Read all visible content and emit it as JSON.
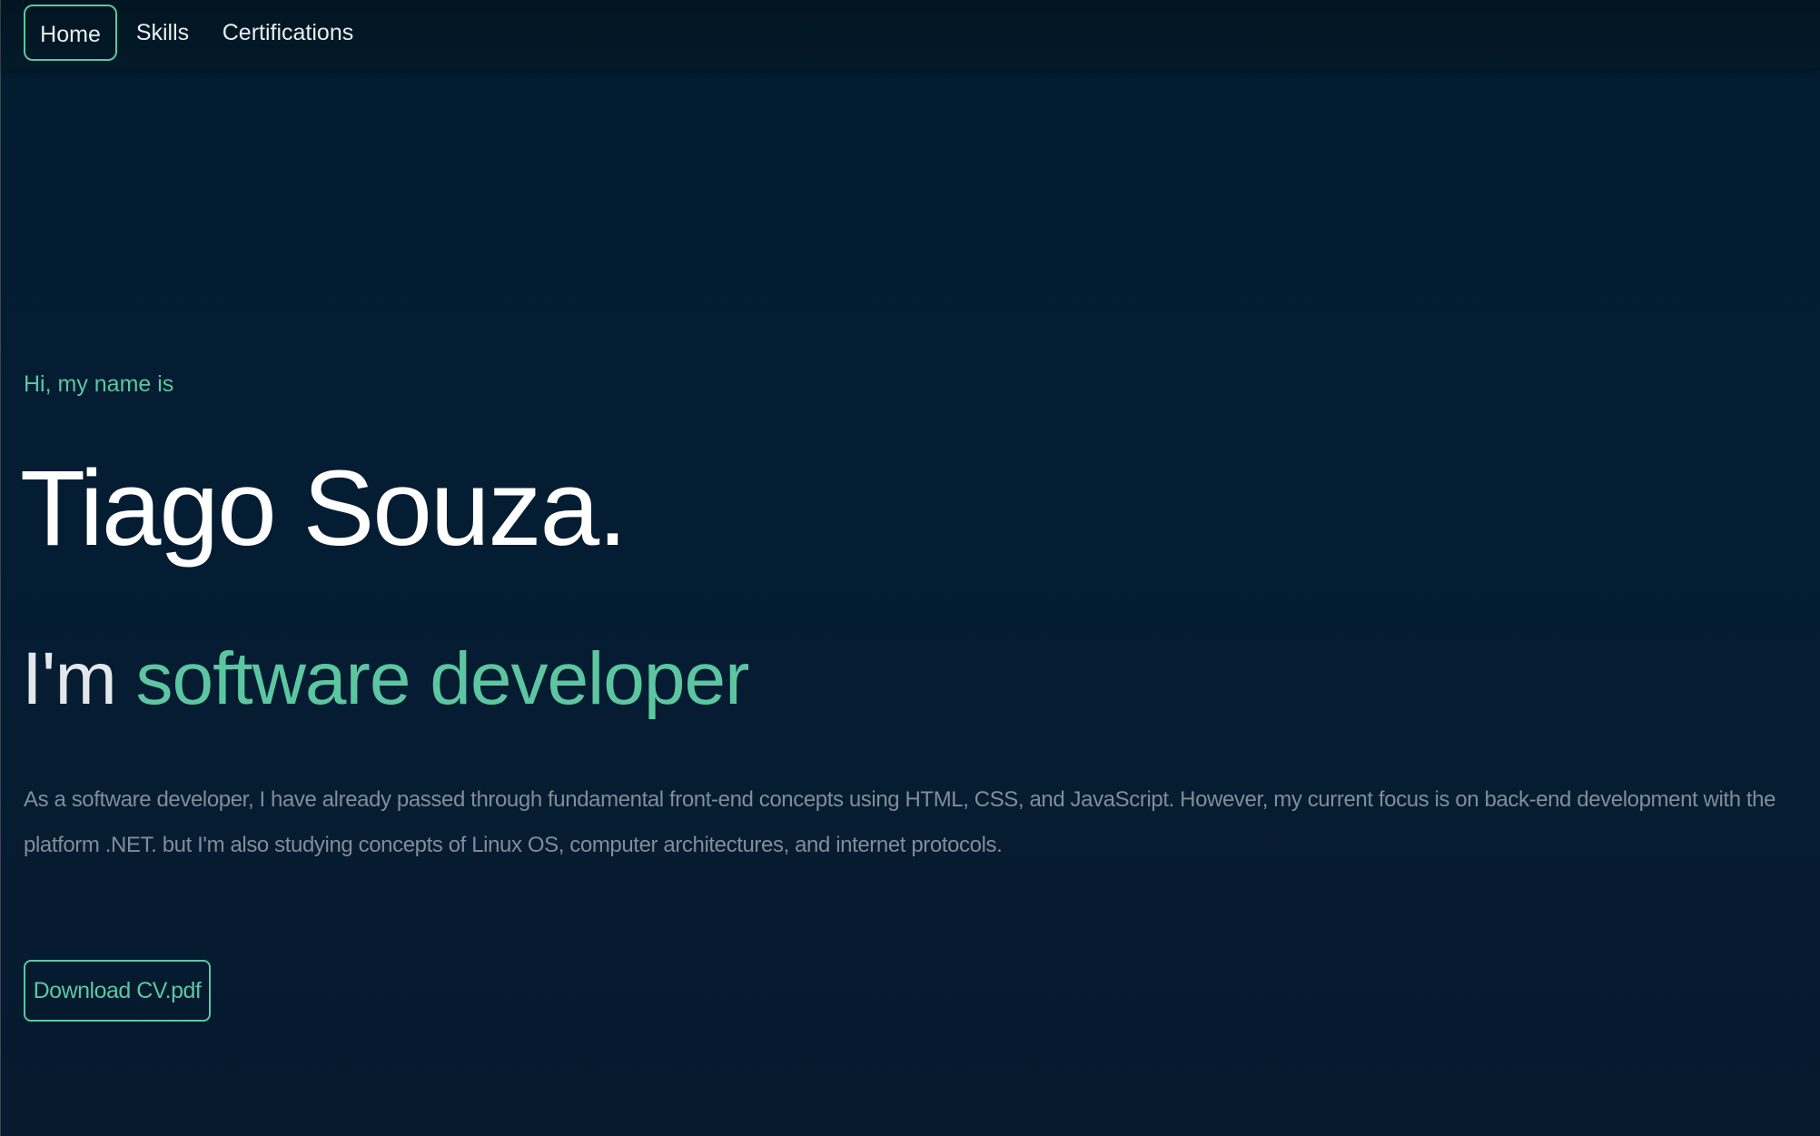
{
  "navbar": {
    "items": [
      {
        "label": "Home",
        "active": true
      },
      {
        "label": "Skills",
        "active": false
      },
      {
        "label": "Certifications",
        "active": false
      }
    ]
  },
  "hero": {
    "greeting": "Hi, my name is",
    "name": "Tiago Souza.",
    "role_prefix": "I'm",
    "role_highlight": "software developer",
    "about": "As a software developer, I have already passed through fundamental front-end concepts using HTML, CSS, and JavaScript. However, my current focus is on back-end development with the platform .NET. but I'm also studying concepts of Linux OS, computer architectures, and internet protocols.",
    "cv_button_label": "Download CV.pdf"
  },
  "colors": {
    "accent": "#5cc6a1",
    "background": "#041d33",
    "navbar_background": "#021521",
    "body_text": "#7f8e98",
    "heading_text": "#ffffff"
  }
}
